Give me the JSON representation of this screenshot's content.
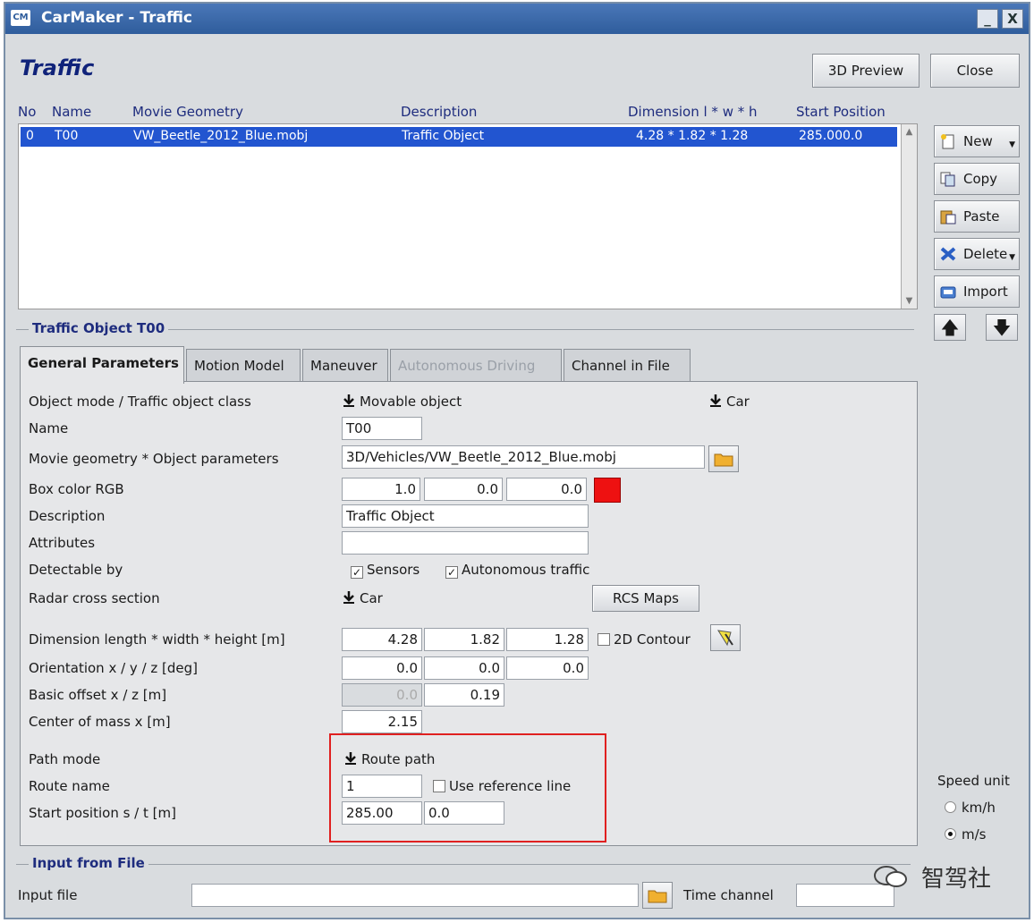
{
  "window": {
    "title": "CarMaker - Traffic",
    "app_icon": "CM",
    "minimize": "_",
    "close": "X"
  },
  "header": {
    "title": "Traffic",
    "preview_button": "3D Preview",
    "close_button": "Close"
  },
  "table": {
    "columns": [
      "No",
      "Name",
      "Movie Geometry",
      "Description",
      "Dimension l * w * h",
      "Start Position"
    ],
    "rows": [
      {
        "no": "0",
        "name": "T00",
        "geometry": "VW_Beetle_2012_Blue.mobj",
        "description": "Traffic Object",
        "dimension": "4.28 * 1.82 * 1.28",
        "start": "285.000.0"
      }
    ]
  },
  "side_buttons": {
    "new": "New",
    "copy": "Copy",
    "paste": "Paste",
    "delete": "Delete",
    "import": "Import"
  },
  "section": {
    "object_title": "Traffic Object T00",
    "input_title": "Input from File"
  },
  "tabs": [
    "General Parameters",
    "Motion Model",
    "Maneuver",
    "Autonomous Driving",
    "Channel in File"
  ],
  "form": {
    "object_mode_label": "Object mode / Traffic object class",
    "object_mode_value": "Movable object",
    "object_class_value": "Car",
    "name_label": "Name",
    "name_value": "T00",
    "geometry_label": "Movie geometry * Object parameters",
    "geometry_value": "3D/Vehicles/VW_Beetle_2012_Blue.mobj",
    "box_color_label": "Box color RGB",
    "box_color": [
      "1.0",
      "0.0",
      "0.0"
    ],
    "box_color_hex": "#ee1111",
    "description_label": "Description",
    "description_value": "Traffic Object",
    "attributes_label": "Attributes",
    "attributes_value": "",
    "detectable_label": "Detectable by",
    "detectable_sensors": "Sensors",
    "detectable_traffic": "Autonomous traffic",
    "radar_label": "Radar cross section",
    "radar_value": "Car",
    "rcs_button": "RCS Maps",
    "dimension_label": "Dimension length * width * height [m]",
    "dimension": [
      "4.28",
      "1.82",
      "1.28"
    ],
    "contour_label": "2D Contour",
    "orientation_label": "Orientation x / y / z [deg]",
    "orientation": [
      "0.0",
      "0.0",
      "0.0"
    ],
    "offset_label": "Basic offset x / z [m]",
    "offset": [
      "0.0",
      "0.19"
    ],
    "mass_label": "Center of mass x [m]",
    "mass_value": "2.15",
    "path_label": "Path mode",
    "path_value": "Route path",
    "route_label": "Route name",
    "route_value": "1",
    "ref_line_label": "Use reference line",
    "start_label": "Start position s / t [m]",
    "start_s": "285.00",
    "start_t": "0.0"
  },
  "speed_unit": {
    "label": "Speed unit",
    "kmh": "km/h",
    "ms": "m/s",
    "selected": "m/s"
  },
  "input_file": {
    "label": "Input file",
    "value": "",
    "time_channel_label": "Time channel",
    "time_channel_value": ""
  },
  "watermark": "智驾社",
  "colors": {
    "selection": "#2255d0",
    "heading": "#10237a",
    "highlight": "#e02020"
  }
}
